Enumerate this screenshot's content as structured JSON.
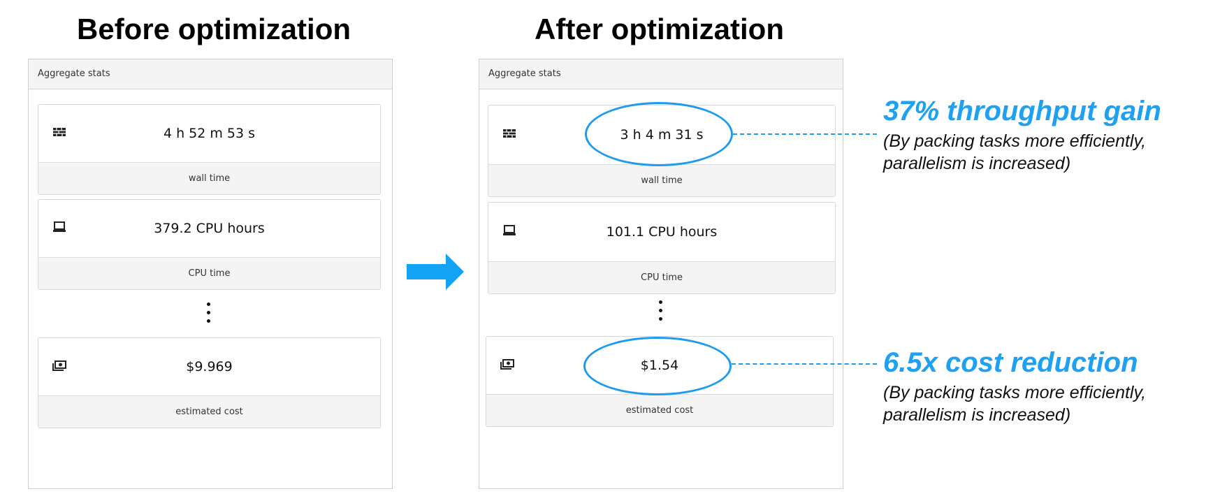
{
  "headings": {
    "before": "Before optimization",
    "after": "After optimization"
  },
  "before_panel": {
    "header": "Aggregate stats",
    "cards": [
      {
        "icon": "wall-clock-icon",
        "value": "4 h 52 m 53 s",
        "label": "wall time"
      },
      {
        "icon": "computer-icon",
        "value": "379.2 CPU hours",
        "label": "CPU time"
      },
      {
        "icon": "money-icon",
        "value": "$9.969",
        "label": "estimated cost"
      }
    ]
  },
  "after_panel": {
    "header": "Aggregate stats",
    "cards": [
      {
        "icon": "wall-clock-icon",
        "value": "3 h 4 m 31 s",
        "label": "wall time"
      },
      {
        "icon": "computer-icon",
        "value": "101.1 CPU hours",
        "label": "CPU time"
      },
      {
        "icon": "money-icon",
        "value": "$1.54",
        "label": "estimated cost"
      }
    ]
  },
  "annotations": {
    "throughput": {
      "title": "37% throughput gain",
      "subtitle_line1": "(By packing tasks more efficiently,",
      "subtitle_line2": "parallelism is increased)"
    },
    "cost": {
      "title": "6.5x cost reduction",
      "subtitle_line1": "(By packing tasks more efficiently,",
      "subtitle_line2": "parallelism is increased)"
    }
  },
  "colors": {
    "accent": "#1e9bef",
    "arrow": "#12a3f5",
    "card_label_bg": "#f4f4f4",
    "border": "#d8d8d8"
  }
}
